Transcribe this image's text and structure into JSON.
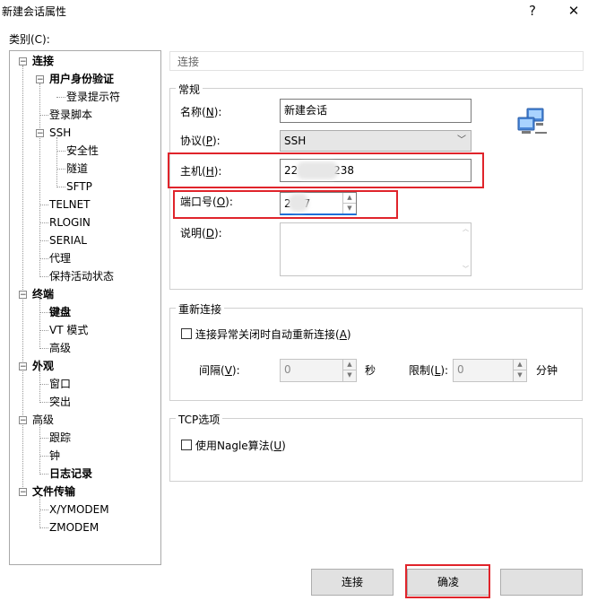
{
  "window": {
    "title": "新建会话属性",
    "help_glyph": "?",
    "close_glyph": "✕"
  },
  "category_label": "类别(C):",
  "tree": {
    "connection": "连接",
    "user_auth": "用户身份验证",
    "login_prompt": "登录提示符",
    "login_script": "登录脚本",
    "ssh": "SSH",
    "security": "安全性",
    "tunnel": "隧道",
    "sftp": "SFTP",
    "telnet": "TELNET",
    "rlogin": "RLOGIN",
    "serial": "SERIAL",
    "proxy": "代理",
    "keepalive": "保持活动状态",
    "terminal": "终端",
    "keyboard": "键盘",
    "vt_mode": "VT 模式",
    "advanced1": "高级",
    "appearance": "外观",
    "window": "窗口",
    "highlight": "突出",
    "advanced2": "高级",
    "trace": "跟踪",
    "bell": "钟",
    "logging": "日志记录",
    "file_transfer": "文件传输",
    "xymodem": "X/YMODEM",
    "zmodem": "ZMODEM"
  },
  "section_header": "连接",
  "general": {
    "title": "常规",
    "name_label": "名称",
    "name_key": "N",
    "name_value": "新建会话",
    "protocol_label": "协议",
    "protocol_key": "P",
    "protocol_value": "SSH",
    "host_label": "主机",
    "host_key": "H",
    "host_prefix": "22",
    "host_suffix": ".238",
    "port_label": "端口号",
    "port_key": "O",
    "port_prefix": "2",
    "port_suffix": "7",
    "desc_label": "说明",
    "desc_key": "D"
  },
  "reconnect": {
    "title": "重新连接",
    "auto_label": "连接异常关闭时自动重新连接(",
    "auto_key": "A",
    "interval_label": "间隔(",
    "interval_key": "V",
    "interval_value": "0",
    "seconds": "秒",
    "limit_label": "限制(",
    "limit_key": "L",
    "limit_value": "0",
    "minutes": "分钟"
  },
  "tcp": {
    "title": "TCP选项",
    "nagle_label": "使用Nagle算法(",
    "nagle_key": "U"
  },
  "buttons": {
    "connect": "连接",
    "ok": "确凌"
  },
  "colors": {
    "highlight_red": "#e0242b"
  }
}
